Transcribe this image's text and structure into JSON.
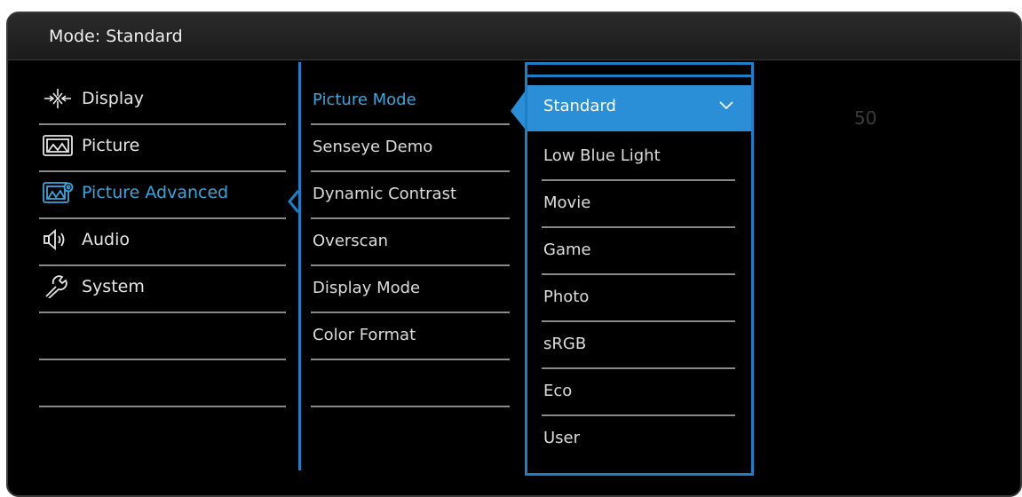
{
  "header": {
    "title": "Mode: Standard"
  },
  "main_menu": [
    {
      "label": "Display",
      "icon": "display-icon"
    },
    {
      "label": "Picture",
      "icon": "picture-icon"
    },
    {
      "label": "Picture Advanced",
      "icon": "picture-advanced-icon",
      "active": true
    },
    {
      "label": "Audio",
      "icon": "audio-icon"
    },
    {
      "label": "System",
      "icon": "system-icon"
    }
  ],
  "sub_menu": [
    {
      "label": "Picture Mode",
      "active": true
    },
    {
      "label": "Senseye Demo"
    },
    {
      "label": "Dynamic Contrast"
    },
    {
      "label": "Overscan"
    },
    {
      "label": "Display Mode"
    },
    {
      "label": "Color Format"
    }
  ],
  "options": [
    {
      "label": "Standard",
      "selected": true
    },
    {
      "label": "Low Blue Light"
    },
    {
      "label": "Movie"
    },
    {
      "label": "Game"
    },
    {
      "label": "Photo"
    },
    {
      "label": "sRGB"
    },
    {
      "label": "Eco"
    },
    {
      "label": "User"
    }
  ],
  "value_display": "50",
  "colors": {
    "accent": "#1e7fc7",
    "highlight": "#2a8fd6",
    "active_text": "#3aa6dd",
    "background": "#000000"
  }
}
